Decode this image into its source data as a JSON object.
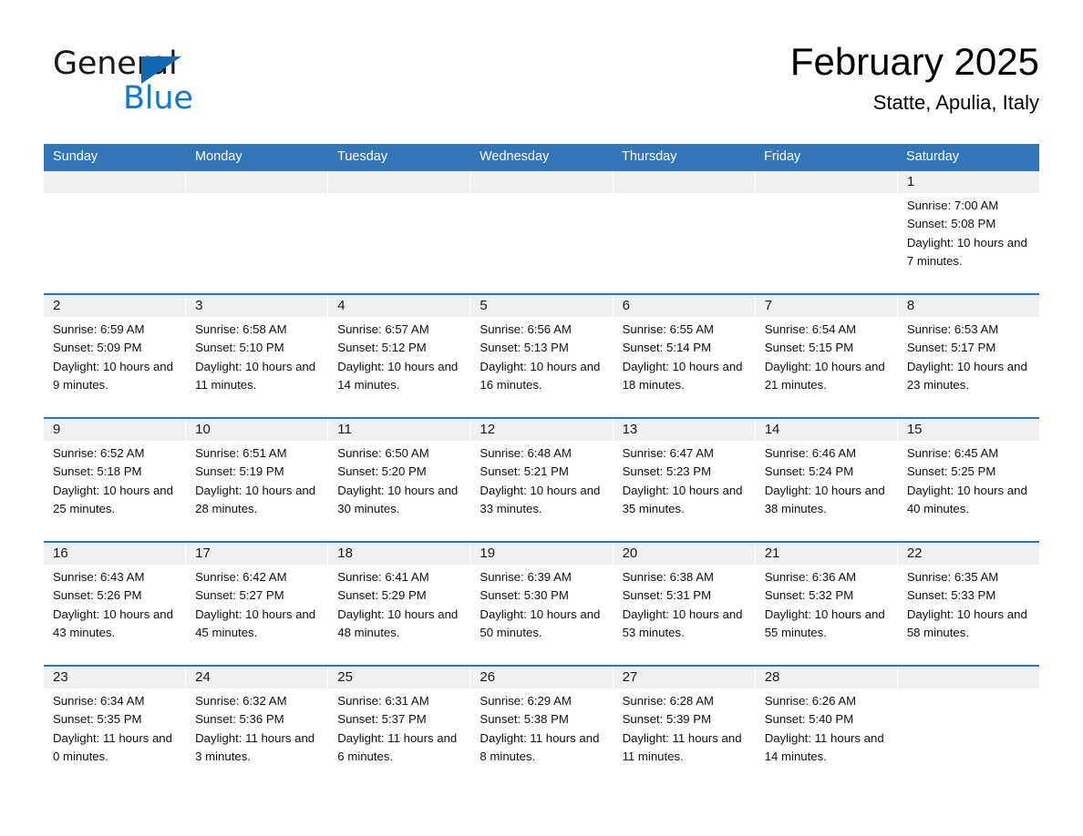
{
  "brand": {
    "name_part1": "General",
    "name_part2": "Blue",
    "triangle_icon": "triangle-icon",
    "color_black": "#1a1a1a",
    "color_blue": "#1279c8"
  },
  "header": {
    "title": "February 2025",
    "subtitle": "Statte, Apulia, Italy"
  },
  "theme": {
    "header_blue": "#3275b8",
    "row_divider_blue": "#3275b8",
    "daynum_band_gray": "#f0f0f0",
    "text_color": "#111111"
  },
  "weekdays": [
    "Sunday",
    "Monday",
    "Tuesday",
    "Wednesday",
    "Thursday",
    "Friday",
    "Saturday"
  ],
  "weeks": [
    [
      {
        "day": "",
        "empty": true
      },
      {
        "day": "",
        "empty": true
      },
      {
        "day": "",
        "empty": true
      },
      {
        "day": "",
        "empty": true
      },
      {
        "day": "",
        "empty": true
      },
      {
        "day": "",
        "empty": true
      },
      {
        "day": "1",
        "sunrise": "Sunrise: 7:00 AM",
        "sunset": "Sunset: 5:08 PM",
        "daylight": "Daylight: 10 hours and 7 minutes."
      }
    ],
    [
      {
        "day": "2",
        "sunrise": "Sunrise: 6:59 AM",
        "sunset": "Sunset: 5:09 PM",
        "daylight": "Daylight: 10 hours and 9 minutes."
      },
      {
        "day": "3",
        "sunrise": "Sunrise: 6:58 AM",
        "sunset": "Sunset: 5:10 PM",
        "daylight": "Daylight: 10 hours and 11 minutes."
      },
      {
        "day": "4",
        "sunrise": "Sunrise: 6:57 AM",
        "sunset": "Sunset: 5:12 PM",
        "daylight": "Daylight: 10 hours and 14 minutes."
      },
      {
        "day": "5",
        "sunrise": "Sunrise: 6:56 AM",
        "sunset": "Sunset: 5:13 PM",
        "daylight": "Daylight: 10 hours and 16 minutes."
      },
      {
        "day": "6",
        "sunrise": "Sunrise: 6:55 AM",
        "sunset": "Sunset: 5:14 PM",
        "daylight": "Daylight: 10 hours and 18 minutes."
      },
      {
        "day": "7",
        "sunrise": "Sunrise: 6:54 AM",
        "sunset": "Sunset: 5:15 PM",
        "daylight": "Daylight: 10 hours and 21 minutes."
      },
      {
        "day": "8",
        "sunrise": "Sunrise: 6:53 AM",
        "sunset": "Sunset: 5:17 PM",
        "daylight": "Daylight: 10 hours and 23 minutes."
      }
    ],
    [
      {
        "day": "9",
        "sunrise": "Sunrise: 6:52 AM",
        "sunset": "Sunset: 5:18 PM",
        "daylight": "Daylight: 10 hours and 25 minutes."
      },
      {
        "day": "10",
        "sunrise": "Sunrise: 6:51 AM",
        "sunset": "Sunset: 5:19 PM",
        "daylight": "Daylight: 10 hours and 28 minutes."
      },
      {
        "day": "11",
        "sunrise": "Sunrise: 6:50 AM",
        "sunset": "Sunset: 5:20 PM",
        "daylight": "Daylight: 10 hours and 30 minutes."
      },
      {
        "day": "12",
        "sunrise": "Sunrise: 6:48 AM",
        "sunset": "Sunset: 5:21 PM",
        "daylight": "Daylight: 10 hours and 33 minutes."
      },
      {
        "day": "13",
        "sunrise": "Sunrise: 6:47 AM",
        "sunset": "Sunset: 5:23 PM",
        "daylight": "Daylight: 10 hours and 35 minutes."
      },
      {
        "day": "14",
        "sunrise": "Sunrise: 6:46 AM",
        "sunset": "Sunset: 5:24 PM",
        "daylight": "Daylight: 10 hours and 38 minutes."
      },
      {
        "day": "15",
        "sunrise": "Sunrise: 6:45 AM",
        "sunset": "Sunset: 5:25 PM",
        "daylight": "Daylight: 10 hours and 40 minutes."
      }
    ],
    [
      {
        "day": "16",
        "sunrise": "Sunrise: 6:43 AM",
        "sunset": "Sunset: 5:26 PM",
        "daylight": "Daylight: 10 hours and 43 minutes."
      },
      {
        "day": "17",
        "sunrise": "Sunrise: 6:42 AM",
        "sunset": "Sunset: 5:27 PM",
        "daylight": "Daylight: 10 hours and 45 minutes."
      },
      {
        "day": "18",
        "sunrise": "Sunrise: 6:41 AM",
        "sunset": "Sunset: 5:29 PM",
        "daylight": "Daylight: 10 hours and 48 minutes."
      },
      {
        "day": "19",
        "sunrise": "Sunrise: 6:39 AM",
        "sunset": "Sunset: 5:30 PM",
        "daylight": "Daylight: 10 hours and 50 minutes."
      },
      {
        "day": "20",
        "sunrise": "Sunrise: 6:38 AM",
        "sunset": "Sunset: 5:31 PM",
        "daylight": "Daylight: 10 hours and 53 minutes."
      },
      {
        "day": "21",
        "sunrise": "Sunrise: 6:36 AM",
        "sunset": "Sunset: 5:32 PM",
        "daylight": "Daylight: 10 hours and 55 minutes."
      },
      {
        "day": "22",
        "sunrise": "Sunrise: 6:35 AM",
        "sunset": "Sunset: 5:33 PM",
        "daylight": "Daylight: 10 hours and 58 minutes."
      }
    ],
    [
      {
        "day": "23",
        "sunrise": "Sunrise: 6:34 AM",
        "sunset": "Sunset: 5:35 PM",
        "daylight": "Daylight: 11 hours and 0 minutes."
      },
      {
        "day": "24",
        "sunrise": "Sunrise: 6:32 AM",
        "sunset": "Sunset: 5:36 PM",
        "daylight": "Daylight: 11 hours and 3 minutes."
      },
      {
        "day": "25",
        "sunrise": "Sunrise: 6:31 AM",
        "sunset": "Sunset: 5:37 PM",
        "daylight": "Daylight: 11 hours and 6 minutes."
      },
      {
        "day": "26",
        "sunrise": "Sunrise: 6:29 AM",
        "sunset": "Sunset: 5:38 PM",
        "daylight": "Daylight: 11 hours and 8 minutes."
      },
      {
        "day": "27",
        "sunrise": "Sunrise: 6:28 AM",
        "sunset": "Sunset: 5:39 PM",
        "daylight": "Daylight: 11 hours and 11 minutes."
      },
      {
        "day": "28",
        "sunrise": "Sunrise: 6:26 AM",
        "sunset": "Sunset: 5:40 PM",
        "daylight": "Daylight: 11 hours and 14 minutes."
      },
      {
        "day": "",
        "empty": true
      }
    ]
  ]
}
